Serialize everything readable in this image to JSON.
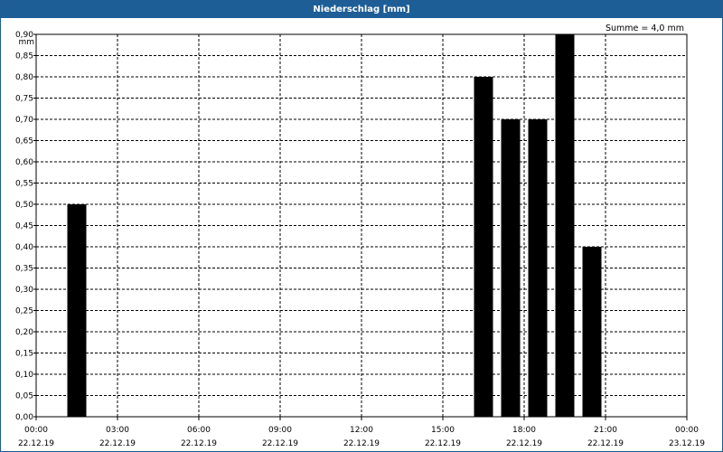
{
  "window": {
    "title": "Niederschlag [mm]"
  },
  "summary": "Summe = 4,0 mm",
  "colors": {
    "titlebar": "#1e5e96",
    "bar": "#000000",
    "grid": "#000000"
  },
  "chart_data": {
    "type": "bar",
    "title": "Niederschlag [mm]",
    "ylabel": "mm",
    "xlabel": "",
    "ylim": [
      0,
      0.9
    ],
    "yticks": [
      "0,00",
      "0,05",
      "0,10",
      "0,15",
      "0,20",
      "0,25",
      "0,30",
      "0,35",
      "0,40",
      "0,45",
      "0,50",
      "0,55",
      "0,60",
      "0,65",
      "0,70",
      "0,75",
      "0,80",
      "0,85",
      "0,90"
    ],
    "xlim_hours": [
      0,
      24
    ],
    "xticks": [
      {
        "time": "00:00",
        "date": "22.12.19"
      },
      {
        "time": "03:00",
        "date": "22.12.19"
      },
      {
        "time": "06:00",
        "date": "22.12.19"
      },
      {
        "time": "09:00",
        "date": "22.12.19"
      },
      {
        "time": "12:00",
        "date": "22.12.19"
      },
      {
        "time": "15:00",
        "date": "22.12.19"
      },
      {
        "time": "18:00",
        "date": "22.12.19"
      },
      {
        "time": "21:00",
        "date": "22.12.19"
      },
      {
        "time": "00:00",
        "date": "23.12.19"
      }
    ],
    "grid": true,
    "bars": [
      {
        "hour": 1.5,
        "value": 0.5
      },
      {
        "hour": 16.5,
        "value": 0.8
      },
      {
        "hour": 17.5,
        "value": 0.7
      },
      {
        "hour": 18.5,
        "value": 0.7
      },
      {
        "hour": 19.5,
        "value": 0.9
      },
      {
        "hour": 20.5,
        "value": 0.4
      }
    ]
  }
}
